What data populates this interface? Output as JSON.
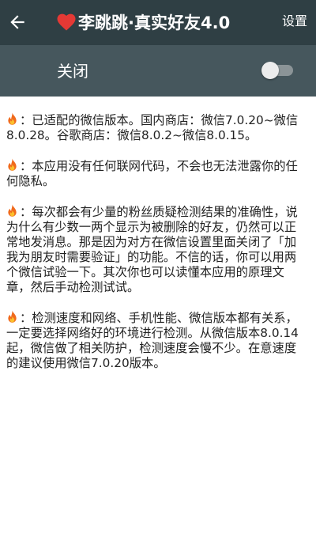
{
  "header": {
    "heart_icon": "heart-icon",
    "title": "李跳跳·真实好友4.0",
    "settings_label": "设置"
  },
  "switch_row": {
    "label": "关闭",
    "state": "off"
  },
  "paragraphs": [
    {
      "icon": "fire-icon",
      "text": "：已适配的微信版本。国内商店：微信7.0.20~微信8.0.28。谷歌商店：微信8.0.2~微信8.0.15。"
    },
    {
      "icon": "fire-icon",
      "text": "：本应用没有任何联网代码，不会也无法泄露你的任何隐私。"
    },
    {
      "icon": "fire-icon",
      "text": "：每次都会有少量的粉丝质疑检测结果的准确性，说为什么有少数一两个显示为被删除的好友，仍然可以正常地发消息。那是因为对方在微信设置里面关闭了「加我为朋友时需要验证」的功能。不信的话，你可以用两个微信试验一下。其次你也可以读懂本应用的原理文章，然后手动检测试试。"
    },
    {
      "icon": "fire-icon",
      "text": "：检测速度和网络、手机性能、微信版本都有关系，一定要选择网络好的环境进行检测。从微信版本8.0.14起，微信做了相关防护，检测速度会慢不少。在意速度的建议使用微信7.0.20版本。"
    }
  ],
  "colors": {
    "appbar": "#2f3f44",
    "switchbar": "#46575d",
    "heart": "#e53935",
    "text": "#222222"
  }
}
